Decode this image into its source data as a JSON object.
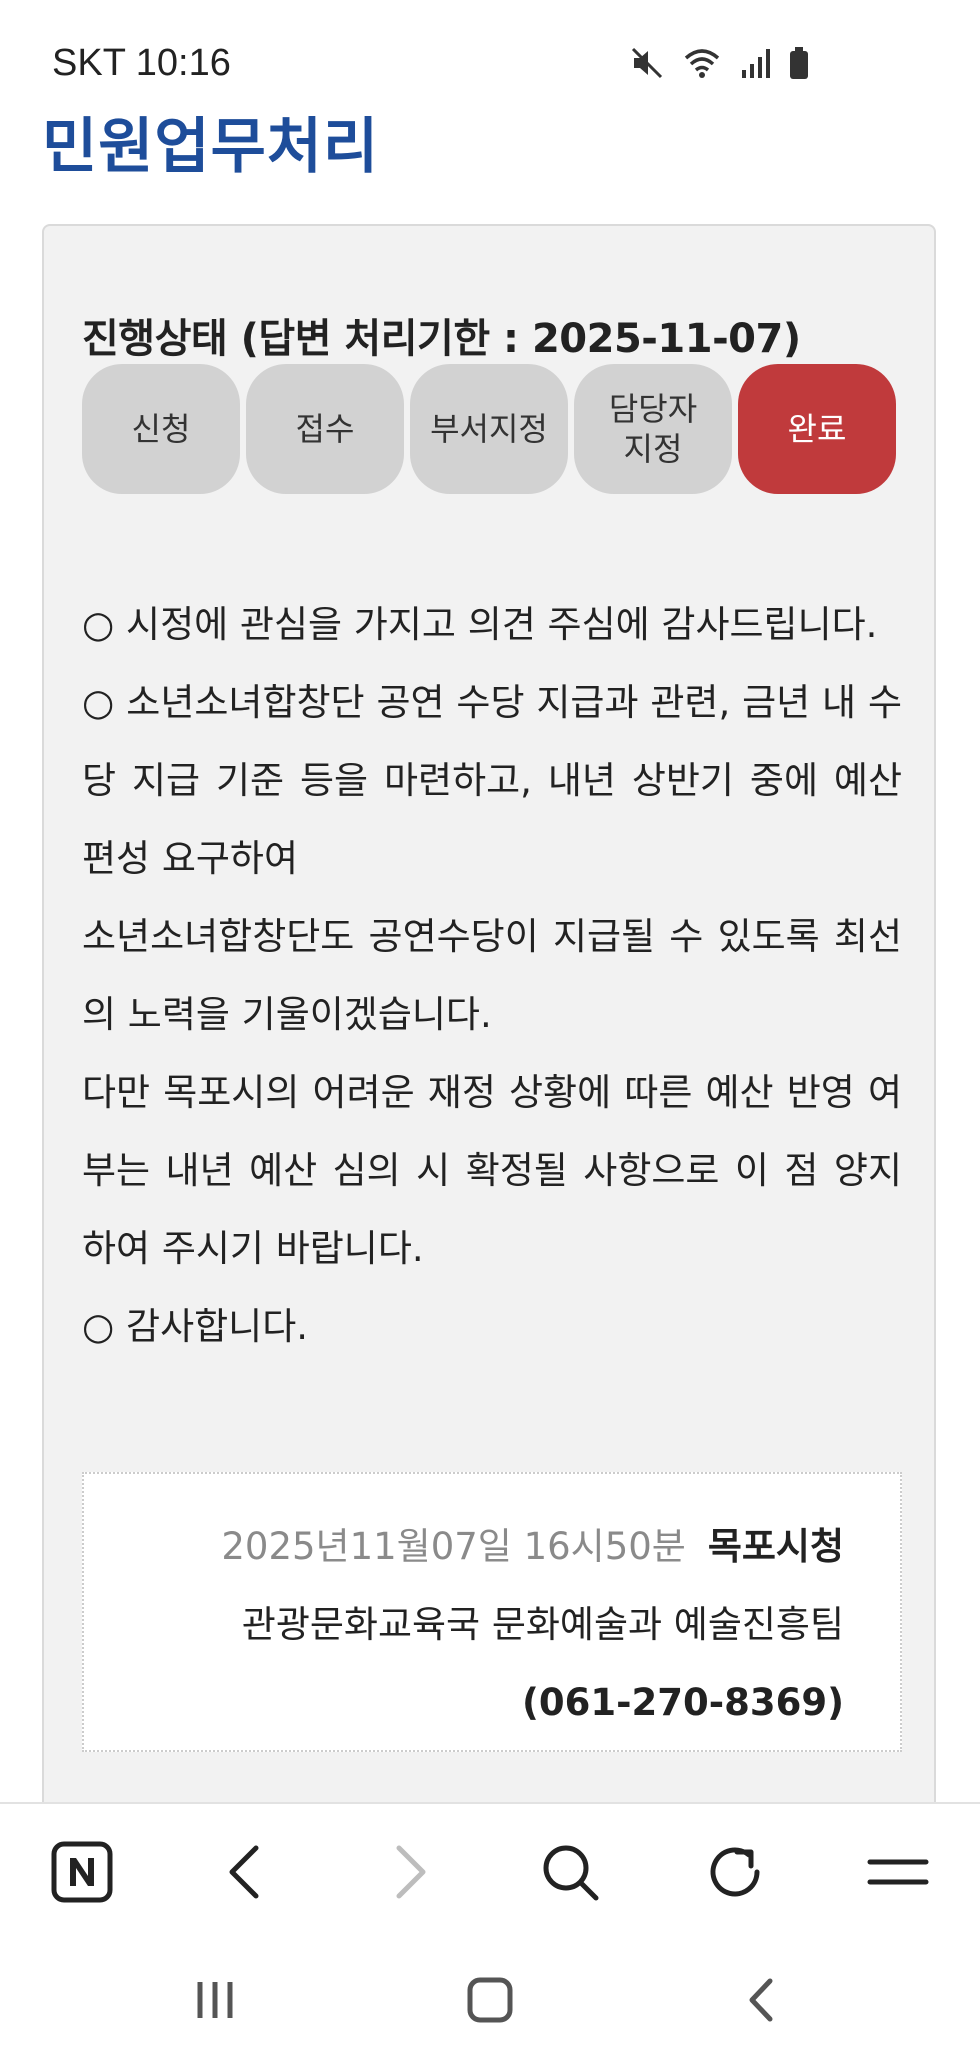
{
  "status_bar": {
    "carrier_time": "SKT 10:16",
    "icons": [
      "mute-icon",
      "wifi-icon",
      "signal-icon",
      "battery-icon"
    ]
  },
  "page": {
    "title": "민원업무처리"
  },
  "progress": {
    "title": "진행상태 (답변 처리기한 : 2025-11-07)",
    "steps": [
      {
        "label": "신청",
        "active": false
      },
      {
        "label": "접수",
        "active": false
      },
      {
        "label": "부서지정",
        "active": false
      },
      {
        "label": "담당자\n지정",
        "active": false
      },
      {
        "label": "완료",
        "active": true
      }
    ],
    "active_color": "#c03a3c"
  },
  "answer": {
    "paragraphs": [
      "○ 시정에 관심을 가지고 의견 주심에 감사드립니다.",
      "○ 소년소녀합창단 공연 수당 지급과 관련, 금년 내 수당 지급 기준 등을 마련하고, 내년 상반기 중에 예산 편성 요구하여",
      "소년소녀합창단도 공연수당이 지급될 수 있도록 최선의 노력을 기울이겠습니다.",
      "다만 목포시의 어려운 재정 상황에 따른 예산 반영 여부는 내년 예산 심의 시 확정될 사항으로 이 점 양지하여 주시기 바랍니다.",
      "○ 감사합니다."
    ]
  },
  "signature": {
    "datetime": "2025년11월07일 16시50분",
    "org": "목포시청",
    "dept": "관광문화교육국 문화예술과 예술진흥팀",
    "phone": "(061-270-8369)"
  },
  "browser_bar": {
    "buttons": [
      "naver-home-icon",
      "back-icon",
      "forward-icon",
      "search-icon",
      "refresh-icon",
      "menu-icon"
    ]
  },
  "nav_bar": {
    "buttons": [
      "recent-apps-icon",
      "home-icon",
      "system-back-icon"
    ]
  },
  "colors": {
    "title": "#1e4d9a",
    "card_bg": "#f2f2f2",
    "step_bg": "#d2d2d2"
  }
}
